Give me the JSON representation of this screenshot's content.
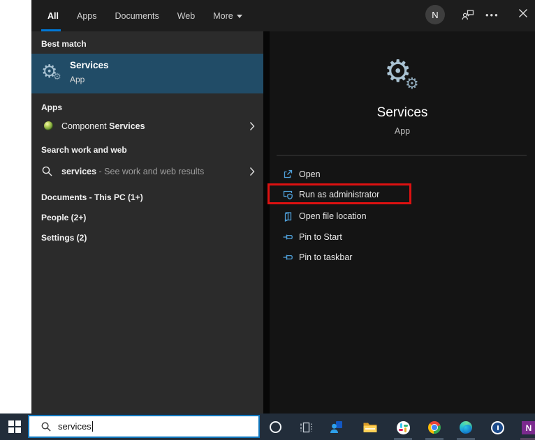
{
  "colors": {
    "accent_blue": "#0078d7",
    "selection_background": "#214c67",
    "action_icon_blue": "#4f9fd8",
    "highlight_red": "#dd1111",
    "taskbar_background": "#222d3a"
  },
  "topbar": {
    "tabs": [
      {
        "label": "All",
        "selected": true
      },
      {
        "label": "Apps",
        "selected": false
      },
      {
        "label": "Documents",
        "selected": false
      },
      {
        "label": "Web",
        "selected": false
      },
      {
        "label": "More",
        "selected": false,
        "has_dropdown": true
      }
    ],
    "avatar_letter": "N",
    "icons": [
      "feedback-icon",
      "ellipsis-icon",
      "close-icon"
    ]
  },
  "left_panel": {
    "best_match_header": "Best match",
    "best_match": {
      "title": "Services",
      "subtitle": "App"
    },
    "apps_header": "Apps",
    "apps": [
      {
        "prefix": "Component ",
        "match": "Services"
      }
    ],
    "search_header": "Search work and web",
    "search_suggestion": {
      "term": "services",
      "suffix": " - See work and web results"
    },
    "groups": [
      "Documents - This PC (1+)",
      "People (2+)",
      "Settings (2)"
    ]
  },
  "right_panel": {
    "app_title": "Services",
    "app_subtitle": "App",
    "actions": [
      {
        "label": "Open",
        "icon": "open-icon",
        "highlighted": false
      },
      {
        "label": "Run as administrator",
        "icon": "admin-shield-icon",
        "highlighted": true
      },
      {
        "label": "Open file location",
        "icon": "file-location-icon",
        "highlighted": false
      },
      {
        "label": "Pin to Start",
        "icon": "pin-icon",
        "highlighted": false
      },
      {
        "label": "Pin to taskbar",
        "icon": "pin-icon",
        "highlighted": false
      }
    ]
  },
  "taskbar": {
    "search_value": "services",
    "icons": [
      "cortana",
      "task-view",
      "people",
      "file-explorer",
      "slack",
      "chrome",
      "edge",
      "1password",
      "onenote"
    ],
    "running_apps": [
      "slack",
      "chrome",
      "edge",
      "onenote"
    ],
    "onenote_letter": "N"
  }
}
